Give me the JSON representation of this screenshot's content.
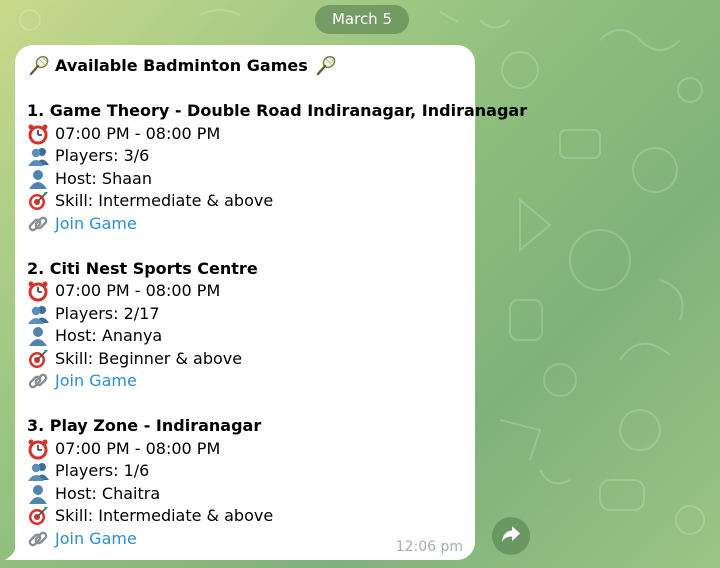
{
  "date_separator": "March 5",
  "message": {
    "title": "Available Badminton Games",
    "time": "12:06 pm",
    "games": [
      {
        "heading": "1. Game Theory - Double Road Indiranagar, Indiranagar",
        "time": "07:00 PM - 08:00 PM",
        "players": "Players: 3/6",
        "host": "Host: Shaan",
        "skill": "Skill: Intermediate & above",
        "link": "Join Game"
      },
      {
        "heading": "2. Citi Nest Sports Centre",
        "time": "07:00 PM - 08:00 PM",
        "players": "Players: 2/17",
        "host": "Host: Ananya",
        "skill": "Skill: Beginner & above",
        "link": "Join Game"
      },
      {
        "heading": "3. Play Zone - Indiranagar",
        "time": "07:00 PM - 08:00 PM",
        "players": "Players: 1/6",
        "host": "Host: Chaitra",
        "skill": "Skill: Intermediate & above",
        "link": "Join Game"
      }
    ]
  },
  "icons": {
    "title": "badminton-racket-icon",
    "time": "alarm-clock-icon",
    "players": "busts-in-silhouette-icon",
    "host": "bust-in-silhouette-icon",
    "skill": "direct-hit-icon",
    "link": "link-icon",
    "share": "share-arrow-icon"
  },
  "colors": {
    "link": "#2b8ed1",
    "timestamp": "#a3adb5",
    "bubble": "#ffffff"
  }
}
